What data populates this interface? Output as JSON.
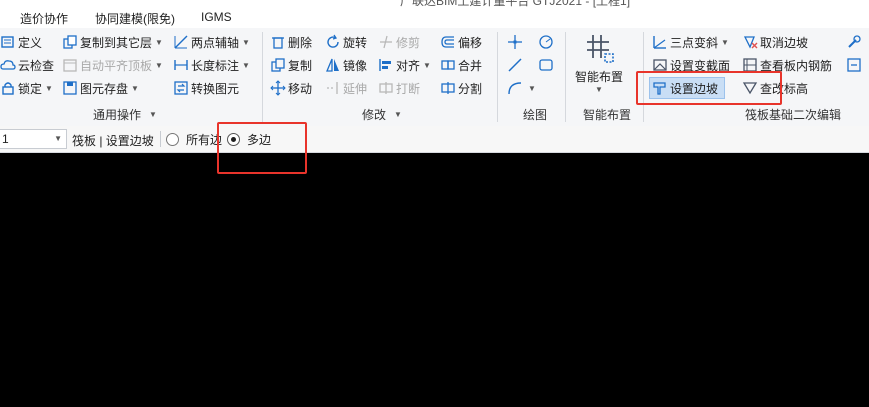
{
  "title_fragment": "广联达BIM土建计量平台 GTJ2021 - [工程1]",
  "menu": [
    "造价协作",
    "协同建模(限免)",
    "IGMS"
  ],
  "groups": {
    "common": {
      "label": "通用操作",
      "items": [
        "定义",
        "云检查",
        "锁定",
        "复制到其它层",
        "自动平齐顶板",
        "图元存盘",
        "两点辅轴",
        "长度标注",
        "转换图元"
      ]
    },
    "modify": {
      "label": "修改",
      "items": [
        "删除",
        "旋转",
        "修剪",
        "偏移",
        "复制",
        "镜像",
        "对齐",
        "合并",
        "移动",
        "延伸",
        "打断",
        "分割"
      ]
    },
    "draw": {
      "label": "绘图"
    },
    "smart": {
      "label": "智能布置",
      "button": "智能布置"
    },
    "raft": {
      "label": "筏板基础二次编辑",
      "items": [
        "三点变斜",
        "取消边坡",
        "设置变截面",
        "查看板内钢筋",
        "设置边坡",
        "查改标高"
      ]
    }
  },
  "toolbar2": {
    "combo_value": "1",
    "breadcrumb": "筏板 | 设置边坡",
    "options": [
      "所有边",
      "多边"
    ],
    "selected": "多边"
  },
  "colors": {
    "accent": "#1e6fc8",
    "highlight_bg": "#c9def5",
    "annotation_red": "#e8342b",
    "canvas": "#000000"
  }
}
